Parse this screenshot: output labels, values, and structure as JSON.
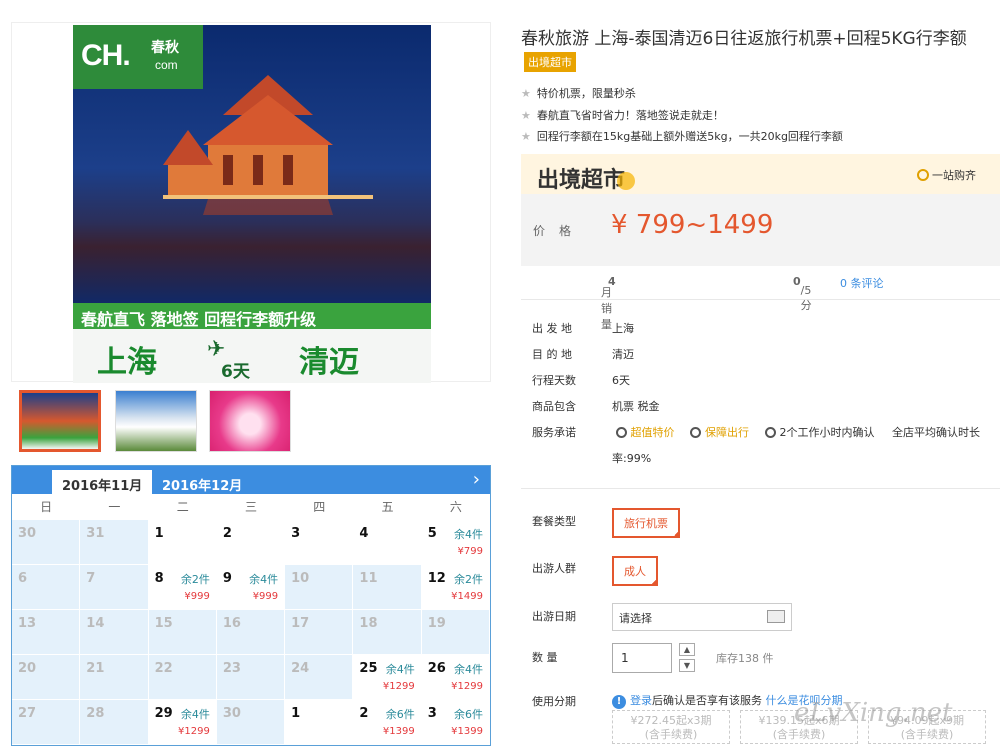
{
  "poster": {
    "logo_text": "CH.",
    "logo_cn": "春秋",
    "logo_domain": "com",
    "banner_text": "春航直飞  落地签  回程行李额升级",
    "from_city": "上海",
    "to_city": "清迈",
    "days": "6天"
  },
  "calendar": {
    "tabs": [
      "2016年11月",
      "2016年12月"
    ],
    "next_icon": "›",
    "weekdays": [
      "日",
      "一",
      "二",
      "三",
      "四",
      "五",
      "六"
    ],
    "rows": [
      [
        {
          "d": "30"
        },
        {
          "d": "31"
        },
        {
          "d": "1",
          "avail": true
        },
        {
          "d": "2",
          "avail": true
        },
        {
          "d": "3",
          "avail": true
        },
        {
          "d": "4",
          "avail": true
        },
        {
          "d": "5",
          "avail": true,
          "r": "余4件",
          "p": "¥799"
        }
      ],
      [
        {
          "d": "6"
        },
        {
          "d": "7"
        },
        {
          "d": "8",
          "avail": true,
          "r": "余2件",
          "p": "¥999"
        },
        {
          "d": "9",
          "avail": true,
          "r": "余4件",
          "p": "¥999"
        },
        {
          "d": "10"
        },
        {
          "d": "11"
        },
        {
          "d": "12",
          "avail": true,
          "r": "余2件",
          "p": "¥1499"
        }
      ],
      [
        {
          "d": "13"
        },
        {
          "d": "14"
        },
        {
          "d": "15"
        },
        {
          "d": "16"
        },
        {
          "d": "17"
        },
        {
          "d": "18"
        },
        {
          "d": "19"
        }
      ],
      [
        {
          "d": "20"
        },
        {
          "d": "21"
        },
        {
          "d": "22"
        },
        {
          "d": "23"
        },
        {
          "d": "24"
        },
        {
          "d": "25",
          "avail": true,
          "r": "余4件",
          "p": "¥1299"
        },
        {
          "d": "26",
          "avail": true,
          "r": "余4件",
          "p": "¥1299"
        }
      ],
      [
        {
          "d": "27"
        },
        {
          "d": "28"
        },
        {
          "d": "29",
          "avail": true,
          "r": "余4件",
          "p": "¥1299"
        },
        {
          "d": "30"
        },
        {
          "d": "1",
          "avail": true
        },
        {
          "d": "2",
          "avail": true,
          "r": "余6件",
          "p": "¥1399"
        },
        {
          "d": "3",
          "avail": true,
          "r": "余6件",
          "p": "¥1399"
        }
      ]
    ]
  },
  "product": {
    "title": "春秋旅游 上海-泰国清迈6日往返旅行机票+回程5KG行李额",
    "tag": "出境超市",
    "features": [
      "特价机票，限量秒杀",
      "春航直飞省时省力！落地签说走就走！",
      "回程行李额在15kg基础上额外赠送5kg，一共20kg回程行李额"
    ],
    "banner_logo": "出境超市",
    "one_stop": "一站购齐",
    "price_label": "价格",
    "price": "¥ 799~1499",
    "sales_label": "月销量",
    "sales_value": "4",
    "rating": "0",
    "rating_of": "/5分",
    "reviews": "0 条评论"
  },
  "details": [
    {
      "k": "出 发 地",
      "v": "上海"
    },
    {
      "k": "目 的 地",
      "v": "清迈"
    },
    {
      "k": "行程天数",
      "v": "6天"
    },
    {
      "k": "商品包含",
      "v": "机票   税金"
    }
  ],
  "service": {
    "label": "服务承诺",
    "items": [
      "超值特价",
      "保障出行",
      "2个工作小时内确认"
    ],
    "rate_line1": "全店平均确认时长",
    "rate_line2": "率:99%"
  },
  "options": {
    "package_label": "套餐类型",
    "package_value": "旅行机票",
    "people_label": "出游人群",
    "people_value": "成人",
    "date_label": "出游日期",
    "date_placeholder": "请选择",
    "qty_label": "数    量",
    "qty_value": "1",
    "stock": "库存138 件",
    "installment_label": "使用分期",
    "installment_login": "登录",
    "installment_text": "后确认是否享有该服务",
    "installment_link": "什么是花呗分期",
    "plans": [
      {
        "a": "¥272.45起x3期",
        "b": "(含手续费)"
      },
      {
        "a": "¥139.15起x6期",
        "b": "(含手续费)"
      },
      {
        "a": "¥94.09起x9期",
        "b": "(含手续费)"
      }
    ]
  },
  "watermark": "eLvXing.net"
}
